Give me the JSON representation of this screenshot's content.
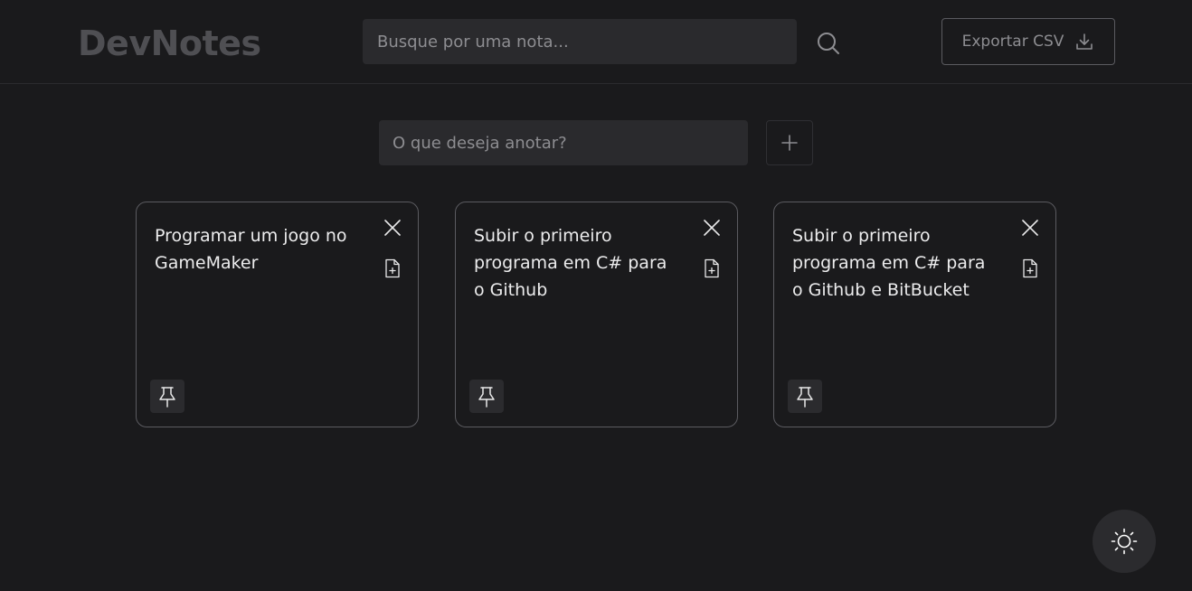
{
  "app": {
    "title": "DevNotes"
  },
  "search": {
    "placeholder": "Busque por uma nota..."
  },
  "export": {
    "label": "Exportar CSV"
  },
  "new_note": {
    "placeholder": "O que deseja anotar?"
  },
  "notes": [
    {
      "text": "Programar um jogo no GameMaker"
    },
    {
      "text": "Subir o primeiro programa em C# para o Github"
    },
    {
      "text": "Subir o primeiro programa em C# para o Github e BitBucket"
    }
  ],
  "icons": {
    "search": "search-icon",
    "export": "download-icon",
    "add": "plus-icon",
    "close": "close-icon",
    "duplicate": "file-plus-icon",
    "pin": "pin-icon",
    "theme": "sun-icon"
  },
  "colors": {
    "background": "#1a1a1c",
    "surface": "#2a2a2d",
    "border": "#5b5b60",
    "muted": "#8d8d91",
    "text": "#e9e9ea"
  }
}
